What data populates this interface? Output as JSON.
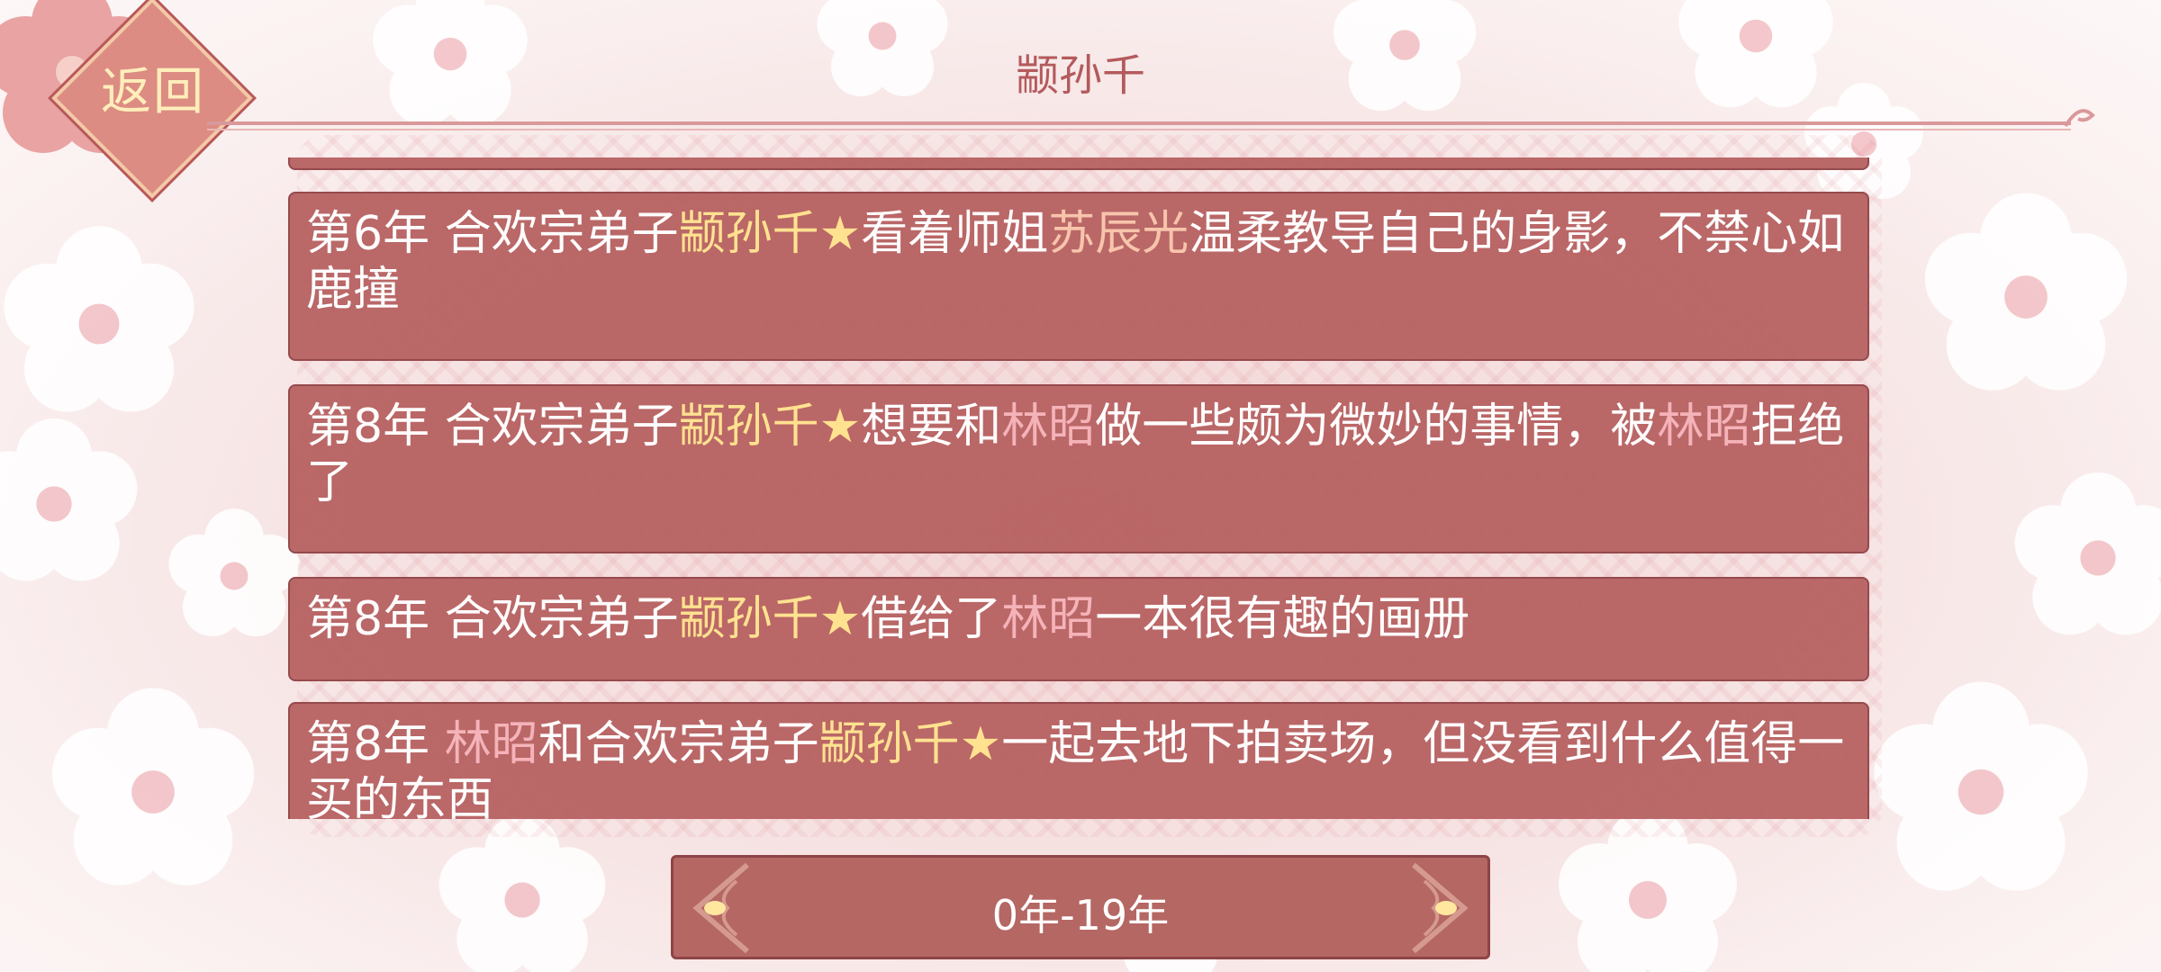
{
  "header": {
    "back_label": "返回",
    "title": "颛孙千"
  },
  "entries": [
    {
      "year": "第6年",
      "parts": [
        {
          "t": " 合欢宗弟子",
          "c": ""
        },
        {
          "t": "颛孙千",
          "c": "main"
        },
        {
          "t": "★",
          "c": "main"
        },
        {
          "t": "看着师姐",
          "c": ""
        },
        {
          "t": "苏辰光",
          "c": "other"
        },
        {
          "t": "温柔教导自己的身影，不禁心如鹿撞",
          "c": ""
        }
      ]
    },
    {
      "year": "第8年",
      "parts": [
        {
          "t": " 合欢宗弟子",
          "c": ""
        },
        {
          "t": "颛孙千",
          "c": "main"
        },
        {
          "t": "★",
          "c": "main"
        },
        {
          "t": "想要和",
          "c": ""
        },
        {
          "t": "林昭",
          "c": "pink"
        },
        {
          "t": "做一些颇为微妙的事情，被",
          "c": ""
        },
        {
          "t": "林昭",
          "c": "pink"
        },
        {
          "t": "拒绝了",
          "c": ""
        }
      ]
    },
    {
      "year": "第8年",
      "parts": [
        {
          "t": " 合欢宗弟子",
          "c": ""
        },
        {
          "t": "颛孙千",
          "c": "main"
        },
        {
          "t": "★",
          "c": "main"
        },
        {
          "t": "借给了",
          "c": ""
        },
        {
          "t": "林昭",
          "c": "pink"
        },
        {
          "t": "一本很有趣的画册",
          "c": ""
        }
      ]
    },
    {
      "year": "第8年",
      "parts": [
        {
          "t": " ",
          "c": ""
        },
        {
          "t": "林昭",
          "c": "pink"
        },
        {
          "t": "和合欢宗弟子",
          "c": ""
        },
        {
          "t": "颛孙千",
          "c": "main"
        },
        {
          "t": "★",
          "c": "main"
        },
        {
          "t": "一起去地下拍卖场，但没看到什么值得一买的东西",
          "c": ""
        }
      ]
    }
  ],
  "footer": {
    "range_label": "0年-19年",
    "prev_icon": "ornate-left-arrow-icon",
    "next_icon": "ornate-right-arrow-icon"
  },
  "colors": {
    "entry_bg": "#b55e5e",
    "name_main": "#ffe28a",
    "name_other": "#f7c2a8",
    "name_pink": "#f4b0b6",
    "title": "#b45a5c"
  }
}
